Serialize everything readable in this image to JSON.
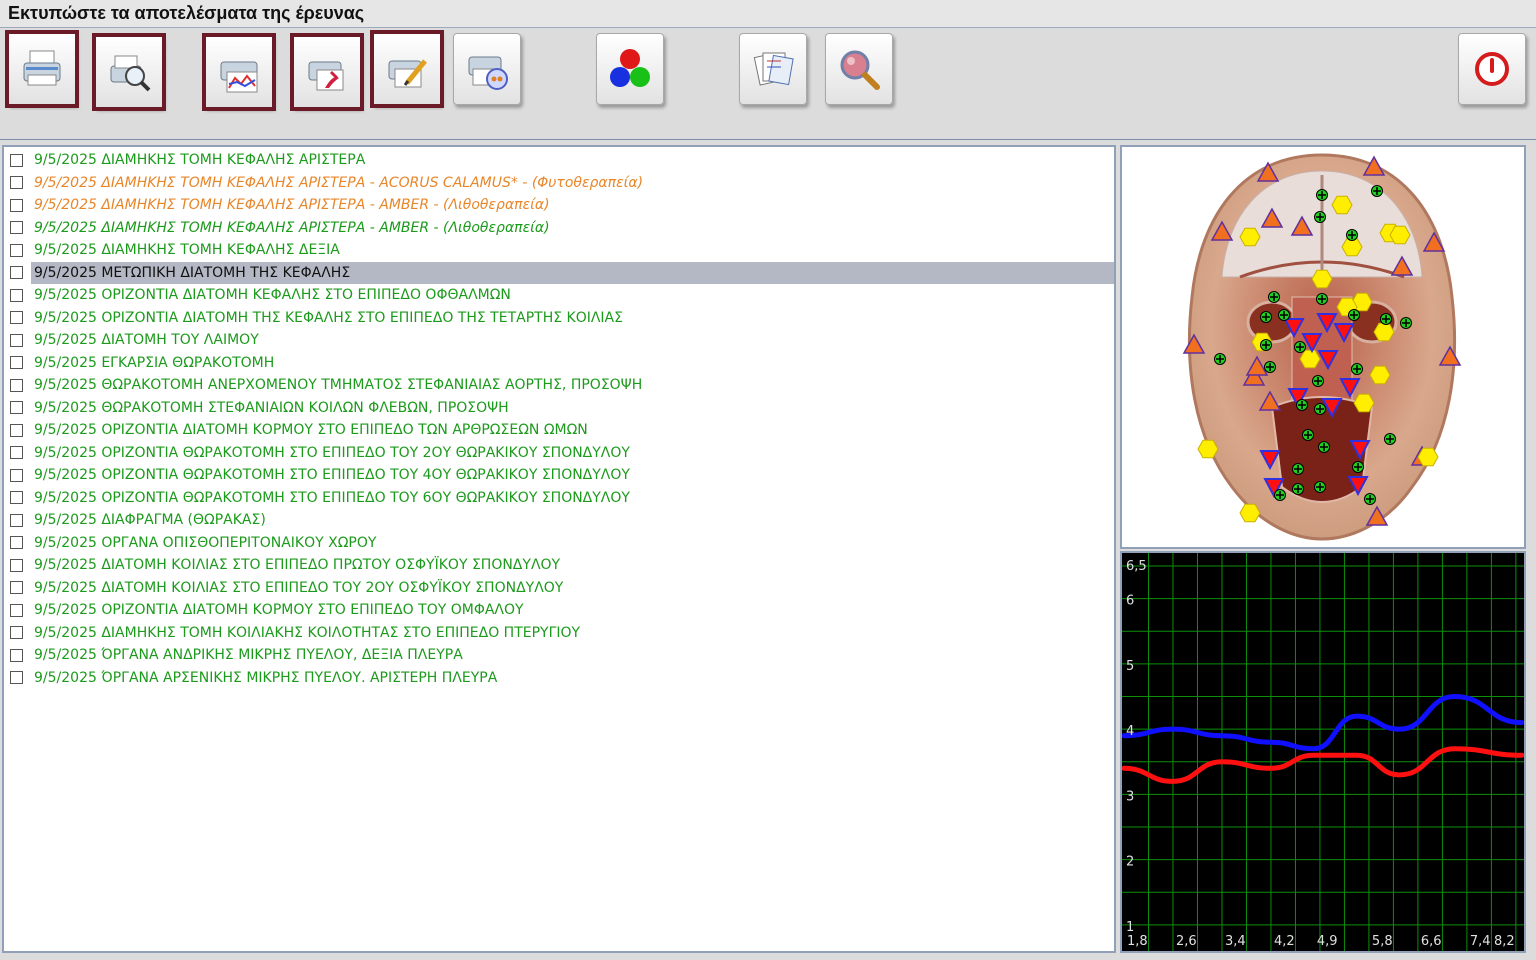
{
  "window": {
    "title": "Εκτυπώστε τα αποτελέσματα της έρευνας"
  },
  "toolbar": {
    "buttons": [
      {
        "name": "print-button",
        "icon": "printer-icon",
        "selected": true
      },
      {
        "name": "print-preview-button",
        "icon": "print-preview-icon",
        "selected": true
      },
      {
        "name": "print-chart-button",
        "icon": "print-chart-icon",
        "selected": true
      },
      {
        "name": "print-remedies-button",
        "icon": "print-remedies-icon",
        "selected": true
      },
      {
        "name": "print-notes-button",
        "icon": "print-notes-icon",
        "selected": true
      },
      {
        "name": "print-media-button",
        "icon": "print-media-icon",
        "selected": false
      },
      {
        "name": "color-cubes-button",
        "icon": "color-cubes-icon",
        "selected": false
      },
      {
        "name": "documents-button",
        "icon": "documents-icon",
        "selected": false
      },
      {
        "name": "magnifier-button",
        "icon": "magnifier-icon",
        "selected": false
      },
      {
        "name": "power-button",
        "icon": "power-icon",
        "selected": false
      }
    ]
  },
  "list": {
    "items": [
      {
        "text": "9/5/2025  ΔΙΑΜΗΚΗΣ ΤΟΜΗ ΚΕΦΑΛΗΣ ΑΡΙΣΤΕΡΑ",
        "style": "green"
      },
      {
        "text": "9/5/2025  ΔΙΑΜΗΚΗΣ ΤΟΜΗ ΚΕΦΑΛΗΣ ΑΡΙΣΤΕΡΑ - ACORUS  CALAMUS* - (Φυτοθεραπεία)",
        "style": "orange"
      },
      {
        "text": "9/5/2025  ΔΙΑΜΗΚΗΣ ΤΟΜΗ ΚΕΦΑΛΗΣ ΑΡΙΣΤΕΡΑ - AMBER - (Λιθοθεραπεία)",
        "style": "orange"
      },
      {
        "text": "9/5/2025  ΔΙΑΜΗΚΗΣ ΤΟΜΗ ΚΕΦΑΛΗΣ ΑΡΙΣΤΕΡΑ - AMBER - (Λιθοθεραπεία)",
        "style": "greenit"
      },
      {
        "text": "9/5/2025  ΔΙΑΜΗΚΗΣ ΤΟΜΗ ΚΕΦΑΛΗΣ ΔΕΞΙΑ",
        "style": "green"
      },
      {
        "text": "9/5/2025  ΜΕΤΩΠΙΚΗ ΔΙΑΤΟΜΗ ΤΗΣ ΚΕΦΑΛΗΣ",
        "style": "dark",
        "selected": true
      },
      {
        "text": "9/5/2025  ΟΡΙΖΟΝΤΙΑ ΔΙΑΤΟΜΗ ΚΕΦΑΛΗΣ ΣΤΟ ΕΠΙΠΕΔΟ ΟΦΘΑΛΜΩΝ",
        "style": "green"
      },
      {
        "text": "9/5/2025  ΟΡΙΖΟΝΤΙΑ ΔΙΑΤΟΜΗ ΤΗΣ ΚΕΦΑΛΗΣ ΣΤΟ ΕΠΙΠΕΔΟ ΤΗΣ ΤΕΤΑΡΤΗΣ ΚΟΙΛΙΑΣ",
        "style": "green"
      },
      {
        "text": "9/5/2025  ΔΙΑΤΟΜΗ ΤΟΥ ΛΑΙΜΟΥ",
        "style": "green"
      },
      {
        "text": "9/5/2025  ΕΓΚΑΡΣΙΑ ΘΩΡΑΚΟΤΟΜΗ",
        "style": "green"
      },
      {
        "text": "9/5/2025  ΘΩΡΑΚΟΤΟΜΗ ΑΝΕΡΧΟΜΕΝΟΥ ΤΜΗΜΑΤΟΣ ΣΤΕΦΑΝΙΑΙΑΣ  ΑΟΡΤΗΣ, ΠΡΟΣΟΨΗ",
        "style": "green"
      },
      {
        "text": "9/5/2025  ΘΩΡΑΚΟΤΟΜΗ ΣΤΕΦΑΝΙΑΙΩΝ ΚΟΙΛΩΝ ΦΛΕΒΩΝ, ΠΡΟΣΟΨΗ",
        "style": "green"
      },
      {
        "text": "9/5/2025  ΟΡΙΖΟΝΤΙΑ ΔΙΑΤΟΜΗ ΚΟΡΜΟΥ ΣΤΟ ΕΠΙΠΕΔΟ ΤΩΝ ΑΡΘΡΩΣΕΩΝ ΩΜΩΝ",
        "style": "green"
      },
      {
        "text": "9/5/2025  ΟΡΙΖΟΝΤΙΑ ΘΩΡΑΚΟΤΟΜΗ ΣΤΟ ΕΠΙΠΕΔΟ ΤΟΥ 2ΟΥ ΘΩΡΑΚΙΚΟΥ ΣΠΟΝΔΥΛΟΥ",
        "style": "green"
      },
      {
        "text": "9/5/2025  ΟΡΙΖΟΝΤΙΑ ΘΩΡΑΚΟΤΟΜΗ ΣΤΟ ΕΠΙΠΕΔΟ ΤΟΥ 4ΟΥ ΘΩΡΑΚΙΚΟΥ ΣΠΟΝΔΥΛΟΥ",
        "style": "green"
      },
      {
        "text": "9/5/2025  ΟΡΙΖΟΝΤΙΑ ΘΩΡΑΚΟΤΟΜΗ ΣΤΟ ΕΠΙΠΕΔΟ ΤΟΥ 6ΟΥ ΘΩΡΑΚΙΚΟΥ ΣΠΟΝΔΥΛΟΥ",
        "style": "green"
      },
      {
        "text": "9/5/2025  ΔΙΑΦΡΑΓΜΑ (ΘΩΡΑΚΑΣ)",
        "style": "green"
      },
      {
        "text": "9/5/2025  ΟΡΓΑΝΑ ΟΠΙΣΘΟΠΕΡΙΤΟΝΑΙΚΟΥ ΧΩΡΟΥ",
        "style": "green"
      },
      {
        "text": "9/5/2025  ΔΙΑΤΟΜΗ ΚΟΙΛΙΑΣ ΣΤΟ ΕΠΙΠΕΔΟ ΠΡΩΤΟΥ ΟΣΦΥΪΚΟΥ ΣΠΟΝΔΥΛΟΥ",
        "style": "green"
      },
      {
        "text": "9/5/2025  ΔΙΑΤΟΜΗ  ΚΟΙΛΙΑΣ ΣΤΟ ΕΠΙΠΕΔΟ ΤΟΥ 2ΟΥ ΟΣΦΥΪΚΟΥ ΣΠΟΝΔΥΛΟΥ",
        "style": "green"
      },
      {
        "text": "9/5/2025  ΟΡΙΖΟΝΤΙΑ ΔΙΑΤΟΜΗ ΚΟΡΜΟΥ ΣΤΟ ΕΠΙΠΕΔΟ ΤΟΥ ΟΜΦΑΛΟΥ",
        "style": "green"
      },
      {
        "text": "9/5/2025  ΔΙΑΜΗΚΗΣ ΤΟΜΗ ΚΟΙΛΙΑΚΗΣ ΚΟΙΛΟΤΗΤΑΣ ΣΤΟ ΕΠΙΠΕΔΟ ΠΤΕΡΥΓΙΟΥ",
        "style": "green"
      },
      {
        "text": "9/5/2025  ΌΡΓΑΝΑ ΑΝΔΡΙΚΗΣ ΜΙΚΡΗΣ ΠΥΕΛΟΥ, ΔΕΞΙΑ ΠΛΕΥΡΑ",
        "style": "green"
      },
      {
        "text": "9/5/2025  ΌΡΓΑΝΑ ΑΡΣΕΝΙΚΗΣ ΜΙΚΡΗΣ ΠΥΕΛΟΥ. ΑΡΙΣΤΕΡΗ ΠΛΕΥΡΑ",
        "style": "green"
      }
    ]
  },
  "colors": {
    "green_text": "#1c9a1c",
    "orange_text": "#e8862a",
    "selected_row": "#b4b8c4",
    "selected_button_border": "#6b1b28",
    "series_blue": "#1010ff",
    "series_red": "#ff1010",
    "grid": "#0b8f0b"
  },
  "anatomy_image": {
    "subject": "frontal head section with marker overlay",
    "markers": [
      "orange-triangle",
      "yellow-hexagon",
      "red-inverted-triangle",
      "green-cross"
    ]
  },
  "chart_data": {
    "type": "line",
    "x_ticks": [
      "1,8",
      "2,6",
      "3,4",
      "4,2",
      "4,9",
      "5,8",
      "6,6",
      "7,4",
      "8,2"
    ],
    "y_ticks": [
      "1",
      "2",
      "3",
      "4",
      "5",
      "6",
      "6,5"
    ],
    "xlim": [
      1.8,
      8.3
    ],
    "ylim": [
      0.6,
      6.7
    ],
    "grid": true,
    "series": [
      {
        "color": "#1010ff",
        "x": [
          1.8,
          2.6,
          3.4,
          4.2,
          4.9,
          5.6,
          6.3,
          7.2,
          8.3
        ],
        "y": [
          3.9,
          4.0,
          3.9,
          3.8,
          3.7,
          4.2,
          4.0,
          4.5,
          4.1
        ]
      },
      {
        "color": "#ff1010",
        "x": [
          1.8,
          2.6,
          3.4,
          4.2,
          4.9,
          5.6,
          6.3,
          7.2,
          8.3
        ],
        "y": [
          3.4,
          3.2,
          3.5,
          3.4,
          3.6,
          3.6,
          3.3,
          3.7,
          3.6
        ]
      }
    ]
  }
}
